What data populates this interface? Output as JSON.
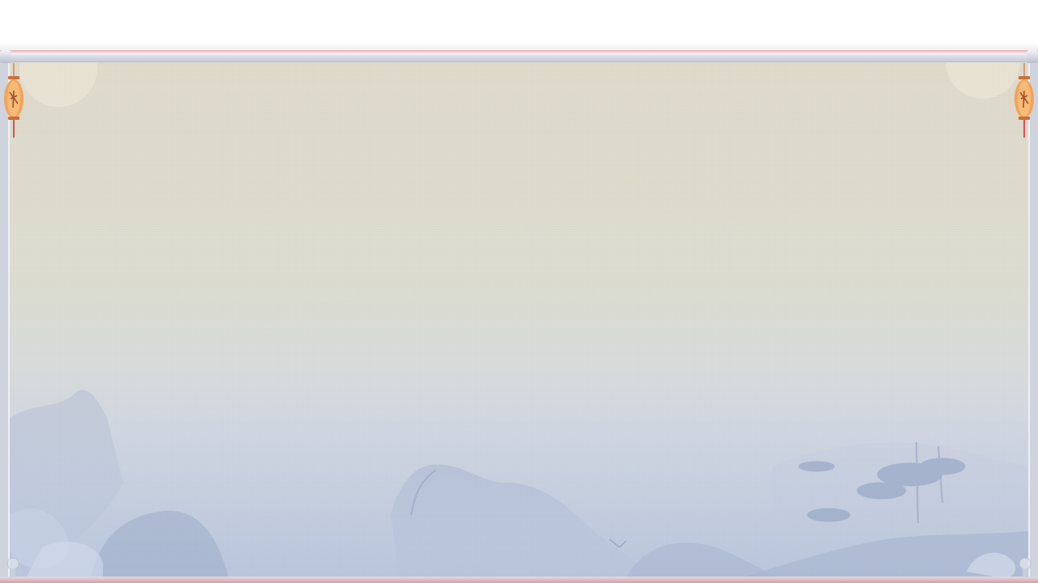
{
  "scene": {
    "name": "empty-scroll-panel",
    "colors": {
      "background": "#ffffff",
      "paper_top": "#ddd8c8",
      "paper_bottom": "#c9d2e2",
      "frame": "#cfd3de",
      "rail_accent": "#e6a9a9",
      "lantern_body": "#f2a35a",
      "lantern_tassel": "#d9534f",
      "ink_wash": "#9fadc9"
    },
    "icons": {
      "left_lantern": "lantern-icon",
      "right_lantern": "lantern-icon"
    }
  }
}
